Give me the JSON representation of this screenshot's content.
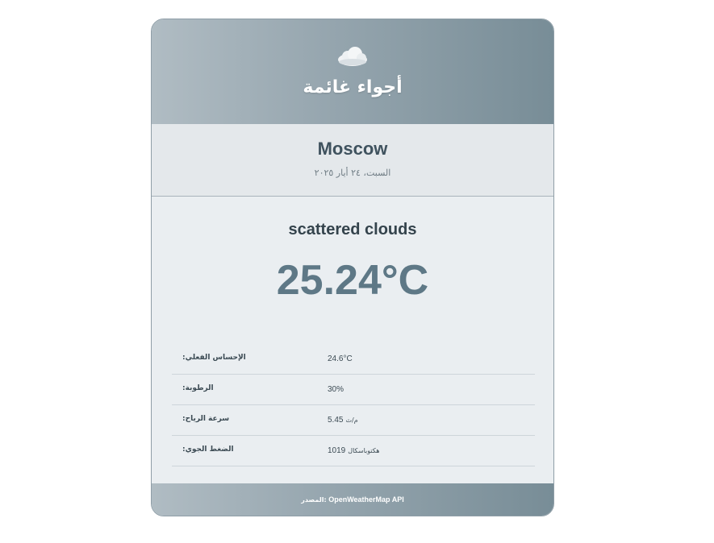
{
  "header": {
    "icon": "cloud-icon",
    "title": "أجواء غائمة"
  },
  "location": {
    "city": "Moscow",
    "date": "السبت، ٢٤ أيار ٢٠٢٥"
  },
  "weather": {
    "description": "scattered clouds",
    "temperature": "25.24°C"
  },
  "details": [
    {
      "label": "الإحساس الفعلي:",
      "value": "24.6°C",
      "unit": ""
    },
    {
      "label": "الرطوبة:",
      "value": "30%",
      "unit": ""
    },
    {
      "label": "سرعة الرياح:",
      "value": "5.45",
      "unit": "م/ث"
    },
    {
      "label": "الضغط الجوي:",
      "value": "1019",
      "unit": "هكتوباسكال"
    }
  ],
  "footer": {
    "label": "المصدر:",
    "source": "OpenWeatherMap API"
  },
  "colors": {
    "header_gradient_start": "#b0bcc3",
    "header_gradient_end": "#788d97",
    "temperature": "#5e7886",
    "city": "#3f525e"
  }
}
